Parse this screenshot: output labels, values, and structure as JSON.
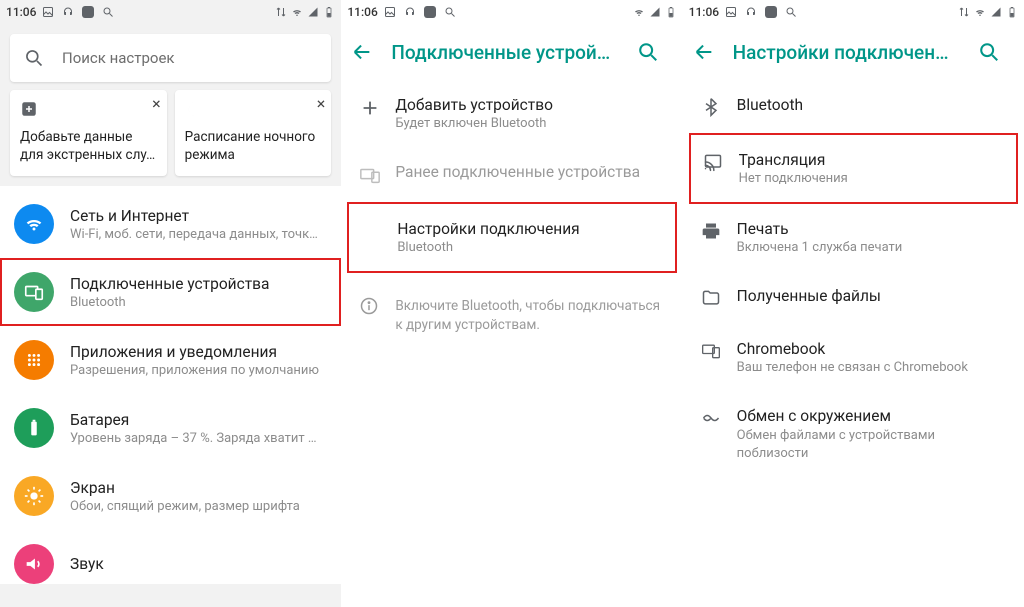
{
  "status": {
    "time": "11:06"
  },
  "phone1": {
    "search_placeholder": "Поиск настроек",
    "card1": "Добавьте данные для экстренных слу…",
    "card2": "Расписание ночного режима",
    "items": [
      {
        "t": "Сеть и Интернет",
        "s": "Wi-Fi, моб. сети, передача данных, точк…"
      },
      {
        "t": "Подключенные устройства",
        "s": "Bluetooth"
      },
      {
        "t": "Приложения и уведомления",
        "s": "Разрешения, приложения по умолчанию"
      },
      {
        "t": "Батарея",
        "s": "Уровень заряда – 37 %. Заряда хватит …"
      },
      {
        "t": "Экран",
        "s": "Обои, спящий режим, размер шрифта"
      },
      {
        "t": "Звук",
        "s": ""
      }
    ]
  },
  "phone2": {
    "title": "Подключенные устрой…",
    "add": {
      "t": "Добавить устройство",
      "s": "Будет включен Bluetooth"
    },
    "prev": "Ранее подключенные устройства",
    "pref": {
      "t": "Настройки подключения",
      "s": "Bluetooth"
    },
    "info": "Включите Bluetooth, чтобы подключаться к другим устройствам."
  },
  "phone3": {
    "title": "Настройки подключен…",
    "items": [
      {
        "t": "Bluetooth",
        "s": ""
      },
      {
        "t": "Трансляция",
        "s": "Нет подключения"
      },
      {
        "t": "Печать",
        "s": "Включена 1 служба печати"
      },
      {
        "t": "Полученные файлы",
        "s": ""
      },
      {
        "t": "Chromebook",
        "s": "Ваш телефон не связан с Chromebook"
      },
      {
        "t": "Обмен с окружением",
        "s": "Обмен файлами с устройствами поблизости"
      }
    ]
  }
}
